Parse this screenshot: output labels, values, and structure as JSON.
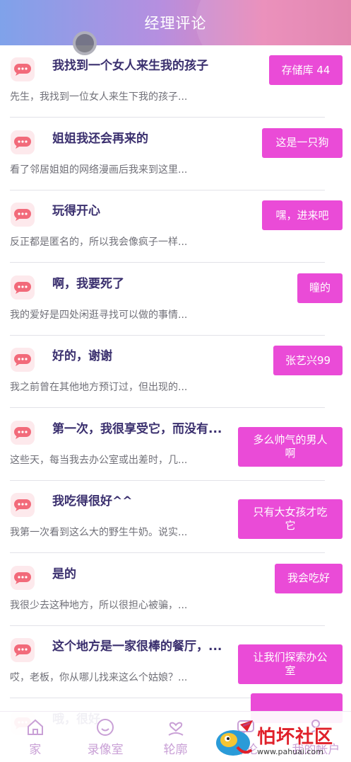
{
  "header": {
    "title": "经理评论"
  },
  "colors": {
    "accent": "#ea4bd7",
    "title": "#3a2f6e"
  },
  "comments": [
    {
      "title": "我找到一个女人来生我的孩子",
      "desc": "先生，我找到一位女人来生下我的孩子...",
      "tag": "存储库 44"
    },
    {
      "title": "姐姐我还会再来的",
      "desc": "看了邻居姐姐的网络漫画后我来到这里...",
      "tag": "这是一只狗"
    },
    {
      "title": "玩得开心",
      "desc": "反正都是匿名的，所以我会像疯子一样...",
      "tag": "嘿，进来吧"
    },
    {
      "title": "啊，我要死了",
      "desc": "我的爱好是四处闲逛寻找可以做的事情...",
      "tag": "瞳的"
    },
    {
      "title": "好的，谢谢",
      "desc": "我之前曾在其他地方预订过，但出现的...",
      "tag": "张艺兴99"
    },
    {
      "title": "第一次，我很享受它，而没有...",
      "desc": "这些天，每当我去办公室或出差时，几...",
      "tag": "多么帅气的男人啊"
    },
    {
      "title": "我吃得很好^^",
      "desc": "我第一次看到这么大的野生牛奶。说实...",
      "tag": "只有大女孩才吃它"
    },
    {
      "title": "是的",
      "desc": "我很少去这种地方，所以很担心被骗，...",
      "tag": "我会吃好"
    },
    {
      "title": "这个地方是一家很棒的餐厅，...",
      "desc": "哎，老板，你从哪儿找来这么个姑娘？...",
      "tag": "让我们探索办公室"
    },
    {
      "title": "哦，很好",
      "desc": "",
      "tag": ""
    }
  ],
  "nav": [
    {
      "label": "家",
      "icon": "home-icon"
    },
    {
      "label": "录像室",
      "icon": "smile-icon"
    },
    {
      "label": "轮廓",
      "icon": "heart-person-icon"
    },
    {
      "label": "评论",
      "icon": "comment-icon"
    },
    {
      "label": "我的帐户",
      "icon": "user-icon"
    }
  ],
  "watermark": {
    "main": "怕坏社区",
    "url": "www.pahuai.com"
  }
}
